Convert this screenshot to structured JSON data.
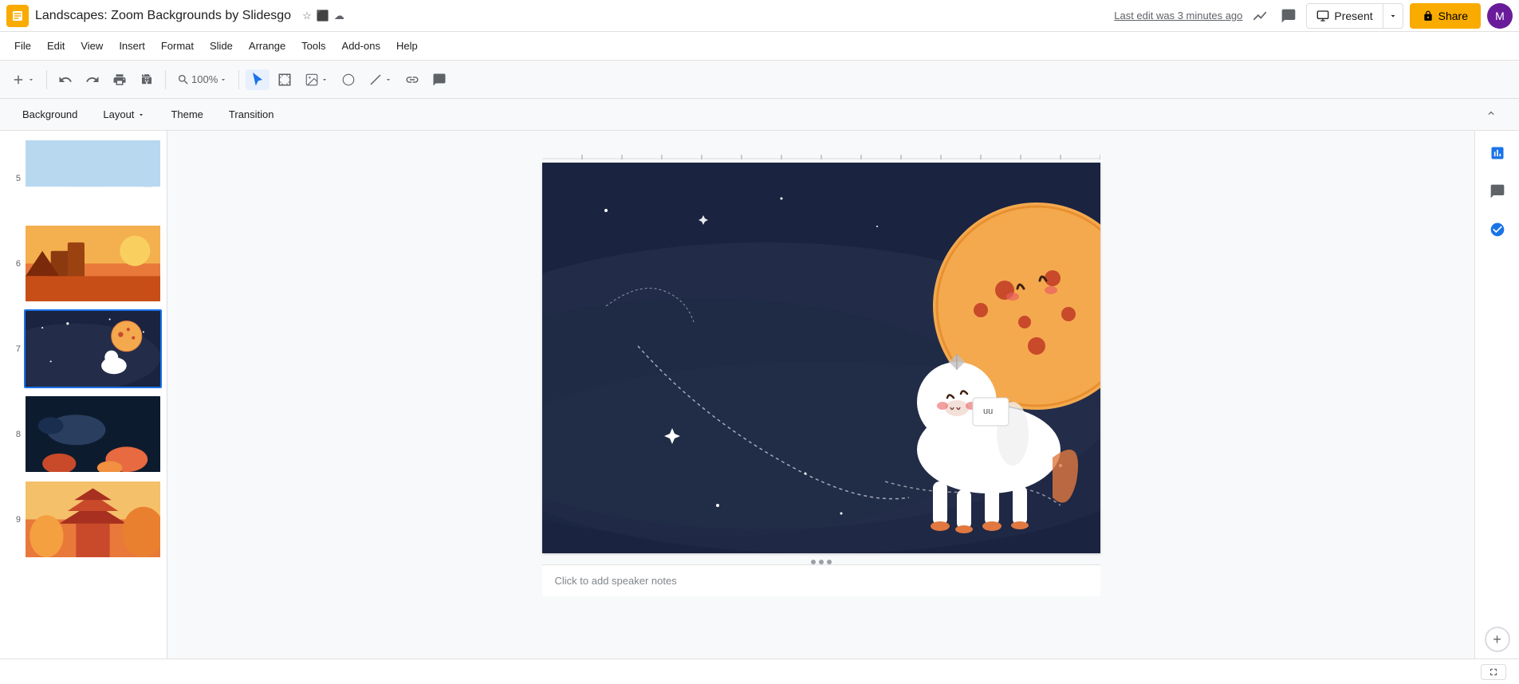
{
  "app": {
    "icon_label": "Slides",
    "title": "Landscapes: Zoom Backgrounds by Slidesgo",
    "last_edit": "Last edit was 3 minutes ago"
  },
  "title_icons": [
    {
      "name": "star-icon",
      "symbol": "☆"
    },
    {
      "name": "slides-icon",
      "symbol": "⬛"
    },
    {
      "name": "cloud-icon",
      "symbol": "☁"
    }
  ],
  "header": {
    "insights_label": "📈",
    "comments_label": "💬",
    "slideshow_label": "⛶",
    "present_label": "Present",
    "share_label": "🔒 Share",
    "avatar_label": "M"
  },
  "menu": {
    "items": [
      {
        "label": "File"
      },
      {
        "label": "Edit"
      },
      {
        "label": "View"
      },
      {
        "label": "Insert"
      },
      {
        "label": "Format"
      },
      {
        "label": "Slide"
      },
      {
        "label": "Arrange"
      },
      {
        "label": "Tools"
      },
      {
        "label": "Add-ons"
      },
      {
        "label": "Help"
      }
    ]
  },
  "toolbar": {
    "undo_label": "↩",
    "redo_label": "↪",
    "print_label": "🖨",
    "paint_label": "🎨",
    "zoom_label": "🔍",
    "zoom_value": "100%",
    "select_label": "↖",
    "shape_label": "⬜",
    "image_label": "🖼",
    "shapes_label": "⬡",
    "line_label": "╱",
    "link_label": "🔗",
    "comment_label": "💬"
  },
  "slide_toolbar": {
    "background_label": "Background",
    "layout_label": "Layout",
    "layout_arrow": "▾",
    "theme_label": "Theme",
    "transition_label": "Transition",
    "collapse_label": "⌃"
  },
  "slides": [
    {
      "number": "5",
      "type": "winter"
    },
    {
      "number": "6",
      "type": "desert"
    },
    {
      "number": "7",
      "type": "space",
      "active": true
    },
    {
      "number": "8",
      "type": "ocean"
    },
    {
      "number": "9",
      "type": "pagoda"
    }
  ],
  "canvas": {
    "notes_placeholder": "Click to add speaker notes"
  },
  "right_sidebar": {
    "explore_label": "Explore",
    "comments_label": "Comments",
    "check_label": "Check",
    "add_label": "+"
  },
  "status": {
    "fit_btn_label": "⤢"
  },
  "colors": {
    "accent": "#1a73e8",
    "share_bg": "#f9ab00",
    "slide_bg": "#1a2340"
  }
}
